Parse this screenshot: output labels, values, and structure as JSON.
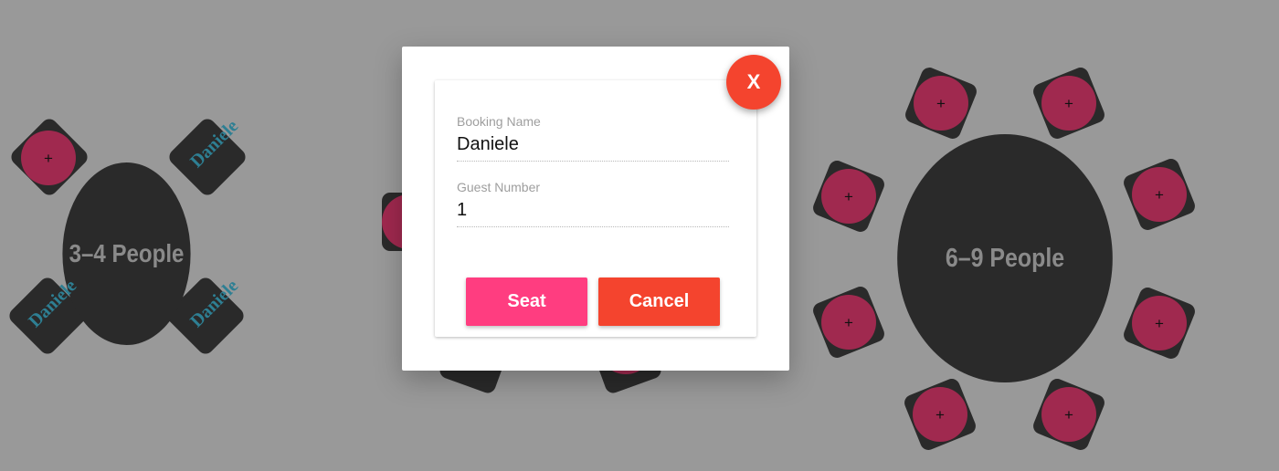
{
  "colors": {
    "background": "#999999",
    "table": "#2a2a2a",
    "seat_button": "#a0294f",
    "guest_name": "#2e7f93",
    "seat_action": "#ff3d80",
    "cancel_action": "#f4442e",
    "close_button": "#f4442e"
  },
  "tables": {
    "left": {
      "label": "3–4 People",
      "chairs": [
        {
          "state": "empty",
          "add_glyph": "+"
        },
        {
          "state": "occupied",
          "guest": "Daniele"
        },
        {
          "state": "occupied",
          "guest": "Daniele"
        },
        {
          "state": "occupied",
          "guest": "Daniele"
        }
      ]
    },
    "right": {
      "label": "6–9 People",
      "chairs": [
        {
          "state": "empty",
          "add_glyph": "+"
        },
        {
          "state": "empty",
          "add_glyph": "+"
        },
        {
          "state": "empty",
          "add_glyph": "+"
        },
        {
          "state": "empty",
          "add_glyph": "+"
        },
        {
          "state": "empty",
          "add_glyph": "+"
        },
        {
          "state": "empty",
          "add_glyph": "+"
        },
        {
          "state": "empty",
          "add_glyph": "+"
        },
        {
          "state": "empty",
          "add_glyph": "+"
        }
      ]
    }
  },
  "modal": {
    "close_label": "X",
    "booking_name_label": "Booking Name",
    "booking_name_value": "Daniele",
    "guest_number_label": "Guest Number",
    "guest_number_value": "1",
    "seat_label": "Seat",
    "cancel_label": "Cancel"
  }
}
